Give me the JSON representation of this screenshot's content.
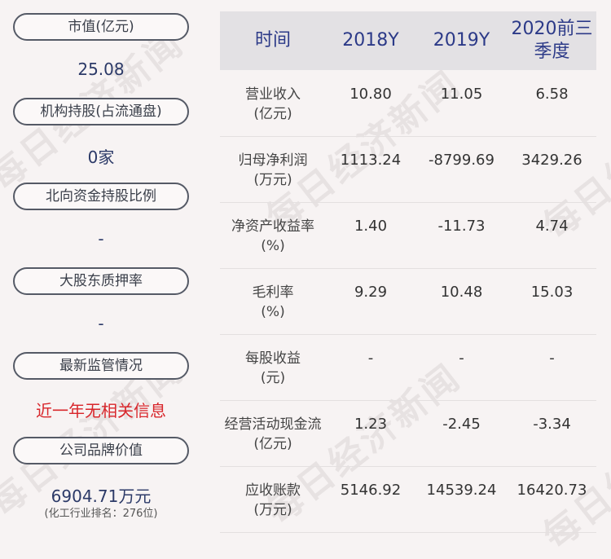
{
  "watermark": "每日经济新闻",
  "left_panel": [
    {
      "label": "市值(亿元)",
      "value": "25.08"
    },
    {
      "label": "机构持股(占流通盘)",
      "value": "0家"
    },
    {
      "label": "北向资金持股比例",
      "value": "-"
    },
    {
      "label": "大股东质押率",
      "value": "-"
    },
    {
      "label": "最新监管情况",
      "value": "近一年无相关信息"
    },
    {
      "label": "公司品牌价值",
      "value": "6904.71万元",
      "sub": "(化工行业排名：276位)"
    }
  ],
  "table": {
    "headers": [
      "时间",
      "2018Y",
      "2019Y",
      "2020前三季度"
    ],
    "rows": [
      {
        "label": "营业收入\n(亿元)",
        "values": [
          "10.80",
          "11.05",
          "6.58"
        ]
      },
      {
        "label": "归母净利润\n(万元)",
        "values": [
          "1113.24",
          "-8799.69",
          "3429.26"
        ]
      },
      {
        "label": "净资产收益率\n(%)",
        "values": [
          "1.40",
          "-11.73",
          "4.74"
        ]
      },
      {
        "label": "毛利率\n(%)",
        "values": [
          "9.29",
          "10.48",
          "15.03"
        ]
      },
      {
        "label": "每股收益\n(元)",
        "values": [
          "-",
          "-",
          "-"
        ]
      },
      {
        "label": "经营活动现金流\n(亿元)",
        "values": [
          "1.23",
          "-2.45",
          "-3.34"
        ]
      },
      {
        "label": "应收账款\n(万元)",
        "values": [
          "5146.92",
          "14539.24",
          "16420.73"
        ]
      }
    ]
  }
}
